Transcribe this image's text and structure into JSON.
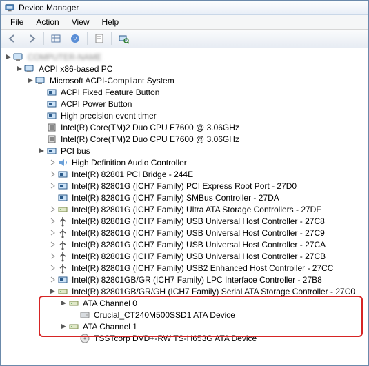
{
  "title": "Device Manager",
  "menu": {
    "file": "File",
    "action": "Action",
    "view": "View",
    "help": "Help"
  },
  "toolbar": {
    "back": "back",
    "forward": "forward",
    "up": "show-hidden",
    "properties": "properties",
    "refresh": "refresh",
    "scan": "scan-hardware"
  },
  "root_blurred": "COMPUTER-NAME",
  "nodes": {
    "acpi_pc": "ACPI x86-based PC",
    "ms_acpi": "Microsoft ACPI-Compliant System",
    "acpi_fixed": "ACPI Fixed Feature Button",
    "acpi_power": "ACPI Power Button",
    "hpet": "High precision event timer",
    "cpu0": "Intel(R) Core(TM)2 Duo CPU    E7600  @ 3.06GHz",
    "cpu1": "Intel(R) Core(TM)2 Duo CPU    E7600  @ 3.06GHz",
    "pci_bus": "PCI bus",
    "hd_audio": "High Definition Audio Controller",
    "pci_bridge": "Intel(R) 82801 PCI Bridge - 244E",
    "pci_express": "Intel(R) 82801G (ICH7 Family) PCI Express Root Port - 27D0",
    "smbus": "Intel(R) 82801G (ICH7 Family) SMBus Controller - 27DA",
    "ultra_ata": "Intel(R) 82801G (ICH7 Family) Ultra ATA Storage Controllers - 27DF",
    "usb_c8": "Intel(R) 82801G (ICH7 Family) USB Universal Host Controller - 27C8",
    "usb_c9": "Intel(R) 82801G (ICH7 Family) USB Universal Host Controller - 27C9",
    "usb_ca": "Intel(R) 82801G (ICH7 Family) USB Universal Host Controller - 27CA",
    "usb_cb": "Intel(R) 82801G (ICH7 Family) USB Universal Host Controller - 27CB",
    "usb2_cc": "Intel(R) 82801G (ICH7 Family) USB2 Enhanced Host Controller - 27CC",
    "lpc": "Intel(R) 82801GB/GR (ICH7 Family) LPC Interface Controller - 27B8",
    "sata": "Intel(R) 82801GB/GR/GH (ICH7 Family) Serial ATA Storage Controller - 27C0",
    "ata0": "ATA Channel 0",
    "crucial": "Crucial_CT240M500SSD1 ATA Device",
    "ata1": "ATA Channel 1",
    "dvd": "TSSTcorp DVD+-RW TS-H653G ATA Device"
  }
}
